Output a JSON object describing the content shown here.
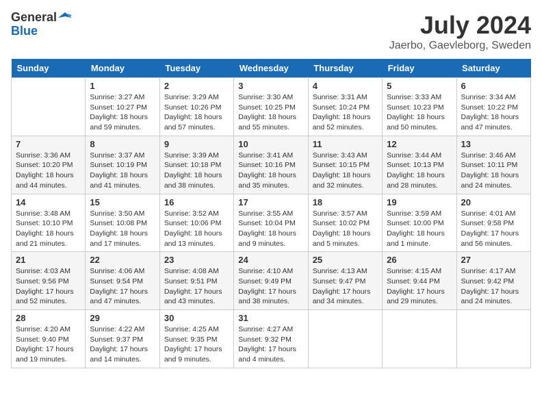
{
  "header": {
    "logo_general": "General",
    "logo_blue": "Blue",
    "month_title": "July 2024",
    "location": "Jaerbo, Gaevleborg, Sweden"
  },
  "days_of_week": [
    "Sunday",
    "Monday",
    "Tuesday",
    "Wednesday",
    "Thursday",
    "Friday",
    "Saturday"
  ],
  "weeks": [
    [
      {
        "date": "",
        "content": ""
      },
      {
        "date": "1",
        "content": "Sunrise: 3:27 AM\nSunset: 10:27 PM\nDaylight: 18 hours\nand 59 minutes."
      },
      {
        "date": "2",
        "content": "Sunrise: 3:29 AM\nSunset: 10:26 PM\nDaylight: 18 hours\nand 57 minutes."
      },
      {
        "date": "3",
        "content": "Sunrise: 3:30 AM\nSunset: 10:25 PM\nDaylight: 18 hours\nand 55 minutes."
      },
      {
        "date": "4",
        "content": "Sunrise: 3:31 AM\nSunset: 10:24 PM\nDaylight: 18 hours\nand 52 minutes."
      },
      {
        "date": "5",
        "content": "Sunrise: 3:33 AM\nSunset: 10:23 PM\nDaylight: 18 hours\nand 50 minutes."
      },
      {
        "date": "6",
        "content": "Sunrise: 3:34 AM\nSunset: 10:22 PM\nDaylight: 18 hours\nand 47 minutes."
      }
    ],
    [
      {
        "date": "7",
        "content": "Sunrise: 3:36 AM\nSunset: 10:20 PM\nDaylight: 18 hours\nand 44 minutes."
      },
      {
        "date": "8",
        "content": "Sunrise: 3:37 AM\nSunset: 10:19 PM\nDaylight: 18 hours\nand 41 minutes."
      },
      {
        "date": "9",
        "content": "Sunrise: 3:39 AM\nSunset: 10:18 PM\nDaylight: 18 hours\nand 38 minutes."
      },
      {
        "date": "10",
        "content": "Sunrise: 3:41 AM\nSunset: 10:16 PM\nDaylight: 18 hours\nand 35 minutes."
      },
      {
        "date": "11",
        "content": "Sunrise: 3:43 AM\nSunset: 10:15 PM\nDaylight: 18 hours\nand 32 minutes."
      },
      {
        "date": "12",
        "content": "Sunrise: 3:44 AM\nSunset: 10:13 PM\nDaylight: 18 hours\nand 28 minutes."
      },
      {
        "date": "13",
        "content": "Sunrise: 3:46 AM\nSunset: 10:11 PM\nDaylight: 18 hours\nand 24 minutes."
      }
    ],
    [
      {
        "date": "14",
        "content": "Sunrise: 3:48 AM\nSunset: 10:10 PM\nDaylight: 18 hours\nand 21 minutes."
      },
      {
        "date": "15",
        "content": "Sunrise: 3:50 AM\nSunset: 10:08 PM\nDaylight: 18 hours\nand 17 minutes."
      },
      {
        "date": "16",
        "content": "Sunrise: 3:52 AM\nSunset: 10:06 PM\nDaylight: 18 hours\nand 13 minutes."
      },
      {
        "date": "17",
        "content": "Sunrise: 3:55 AM\nSunset: 10:04 PM\nDaylight: 18 hours\nand 9 minutes."
      },
      {
        "date": "18",
        "content": "Sunrise: 3:57 AM\nSunset: 10:02 PM\nDaylight: 18 hours\nand 5 minutes."
      },
      {
        "date": "19",
        "content": "Sunrise: 3:59 AM\nSunset: 10:00 PM\nDaylight: 18 hours\nand 1 minute."
      },
      {
        "date": "20",
        "content": "Sunrise: 4:01 AM\nSunset: 9:58 PM\nDaylight: 17 hours\nand 56 minutes."
      }
    ],
    [
      {
        "date": "21",
        "content": "Sunrise: 4:03 AM\nSunset: 9:56 PM\nDaylight: 17 hours\nand 52 minutes."
      },
      {
        "date": "22",
        "content": "Sunrise: 4:06 AM\nSunset: 9:54 PM\nDaylight: 17 hours\nand 47 minutes."
      },
      {
        "date": "23",
        "content": "Sunrise: 4:08 AM\nSunset: 9:51 PM\nDaylight: 17 hours\nand 43 minutes."
      },
      {
        "date": "24",
        "content": "Sunrise: 4:10 AM\nSunset: 9:49 PM\nDaylight: 17 hours\nand 38 minutes."
      },
      {
        "date": "25",
        "content": "Sunrise: 4:13 AM\nSunset: 9:47 PM\nDaylight: 17 hours\nand 34 minutes."
      },
      {
        "date": "26",
        "content": "Sunrise: 4:15 AM\nSunset: 9:44 PM\nDaylight: 17 hours\nand 29 minutes."
      },
      {
        "date": "27",
        "content": "Sunrise: 4:17 AM\nSunset: 9:42 PM\nDaylight: 17 hours\nand 24 minutes."
      }
    ],
    [
      {
        "date": "28",
        "content": "Sunrise: 4:20 AM\nSunset: 9:40 PM\nDaylight: 17 hours\nand 19 minutes."
      },
      {
        "date": "29",
        "content": "Sunrise: 4:22 AM\nSunset: 9:37 PM\nDaylight: 17 hours\nand 14 minutes."
      },
      {
        "date": "30",
        "content": "Sunrise: 4:25 AM\nSunset: 9:35 PM\nDaylight: 17 hours\nand 9 minutes."
      },
      {
        "date": "31",
        "content": "Sunrise: 4:27 AM\nSunset: 9:32 PM\nDaylight: 17 hours\nand 4 minutes."
      },
      {
        "date": "",
        "content": ""
      },
      {
        "date": "",
        "content": ""
      },
      {
        "date": "",
        "content": ""
      }
    ]
  ]
}
